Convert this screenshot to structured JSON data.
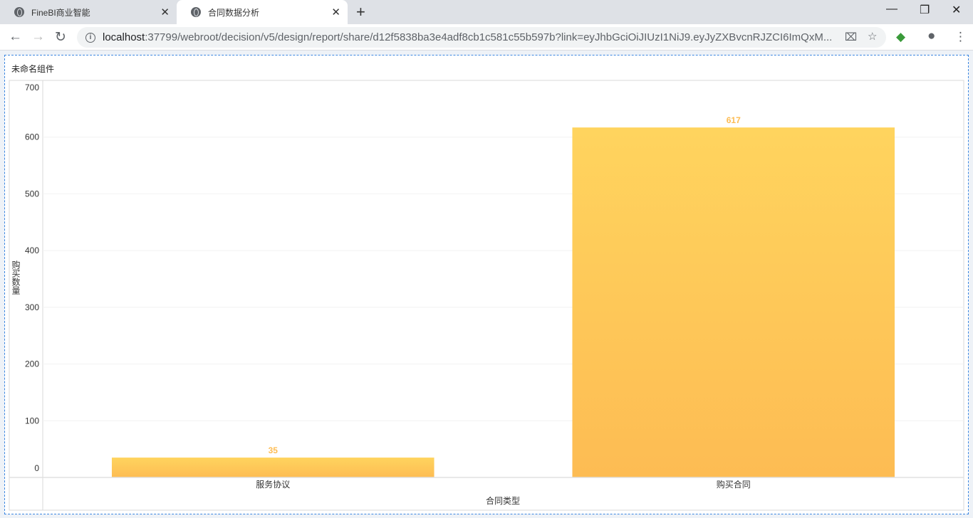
{
  "browser": {
    "tabs": [
      {
        "label": "FineBI商业智能"
      },
      {
        "label": "合同数据分析"
      }
    ],
    "url_host": "localhost",
    "url_rest": ":37799/webroot/decision/v5/design/report/share/d12f5838ba3e4adf8cb1c581c55b597b?link=eyJhbGciOiJIUzI1NiJ9.eyJyZXBvcnRJZCI6ImQxM..."
  },
  "widget": {
    "title": "未命名组件"
  },
  "chart_data": {
    "type": "bar",
    "categories": [
      "服务协议",
      "购买合同"
    ],
    "values": [
      35,
      617
    ],
    "data_labels": [
      "35",
      "617"
    ],
    "xlabel": "合同类型",
    "ylabel": "购买数量",
    "ylim": [
      0,
      700
    ],
    "yticks": [
      "0",
      "100",
      "200",
      "300",
      "400",
      "500",
      "600",
      "700"
    ],
    "grid": true,
    "colors": {
      "bar_top": "#ffd45e",
      "bar_bottom": "#fdbc53",
      "label": "#fdbc53"
    }
  }
}
